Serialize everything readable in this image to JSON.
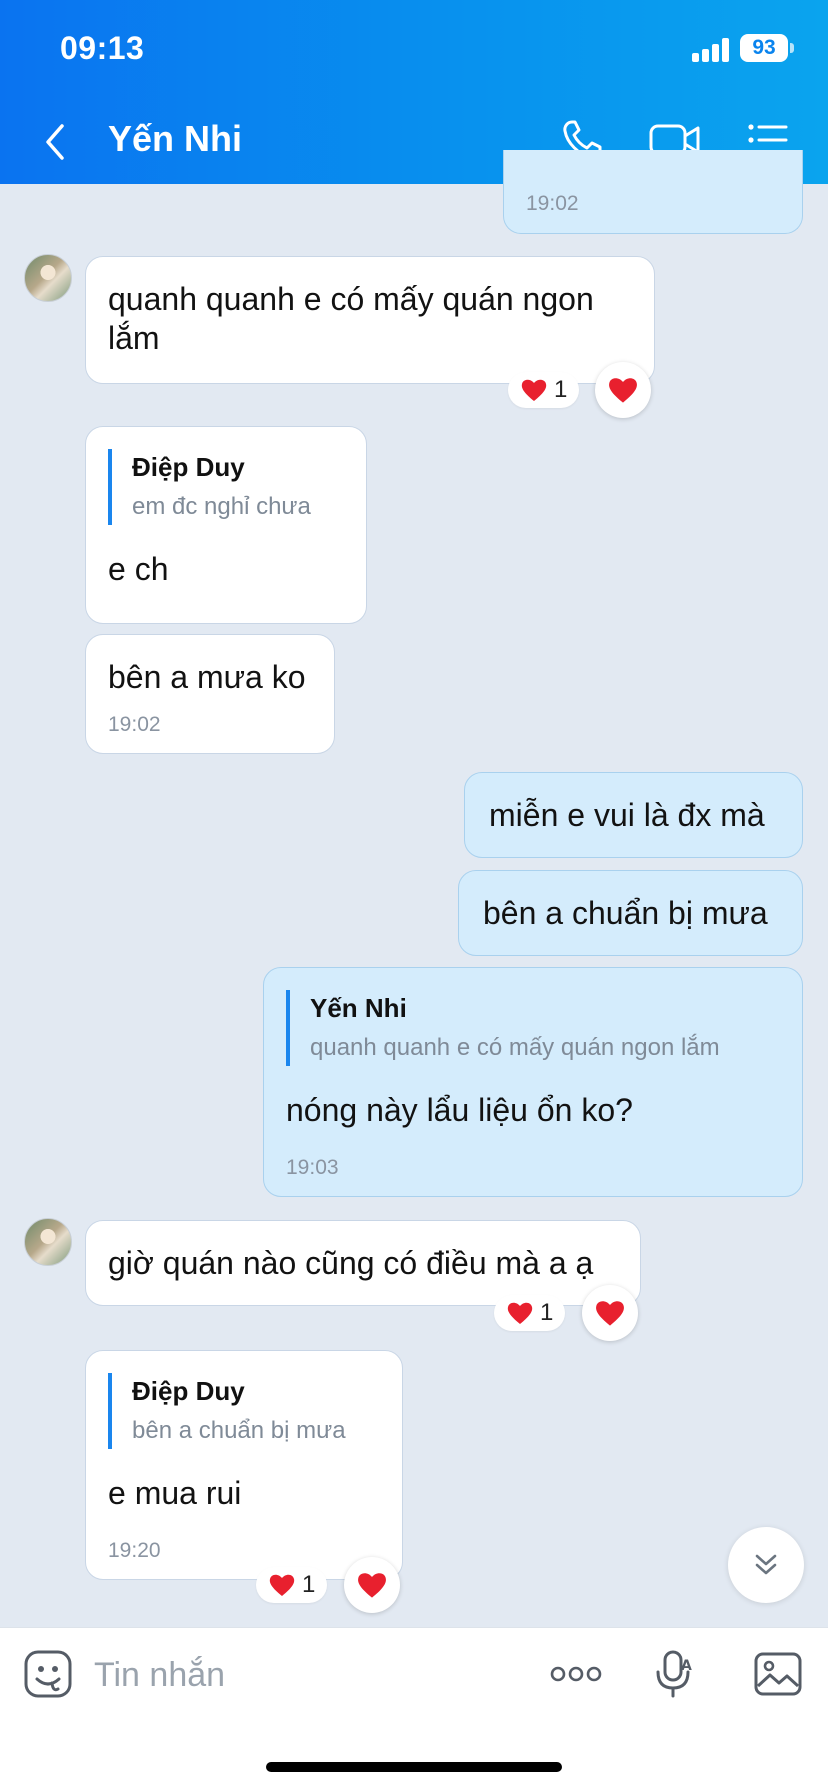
{
  "status_bar": {
    "time": "09:13",
    "battery": "93"
  },
  "header": {
    "contact_name": "Yến Nhi"
  },
  "messages": [
    {
      "time": "19:02"
    },
    {
      "text_line1": "quanh quanh e có mấy quán ngon",
      "text_line2": "lắm",
      "reaction_count": "1"
    },
    {
      "quote_name": "Điệp Duy",
      "quote_text": "em đc nghỉ chưa",
      "text": "e ch"
    },
    {
      "text": "bên a mưa ko",
      "time": "19:02"
    },
    {
      "text": "miễn e vui là đx mà"
    },
    {
      "text": "bên a chuẩn bị mưa"
    },
    {
      "quote_name": "Yến Nhi",
      "quote_text": "quanh quanh e có mấy quán ngon lắm",
      "text": "nóng này lẩu liệu ổn ko?",
      "time": "19:03"
    },
    {
      "text": "giờ quán nào cũng có điều mà a ạ",
      "reaction_count": "1"
    },
    {
      "quote_name": "Điệp Duy",
      "quote_text": "bên a chuẩn bị mưa",
      "text": "e mua rui",
      "time": "19:20",
      "reaction_count": "1"
    }
  ],
  "composer": {
    "placeholder": "Tin nhắn"
  },
  "icons": {
    "back": "chevron-left-icon",
    "call": "phone-icon",
    "video": "video-icon",
    "menu": "list-icon",
    "reaction": "heart-icon",
    "scroll": "double-chevron-down-icon",
    "sticker": "sticker-icon",
    "more": "more-dots-icon",
    "voice": "microphone-icon",
    "gallery": "image-icon"
  },
  "colors": {
    "accent": "#0a84ee",
    "outgoing_bubble": "#d4ecfc",
    "background": "#e2e9f2",
    "heart": "#e8202e"
  }
}
